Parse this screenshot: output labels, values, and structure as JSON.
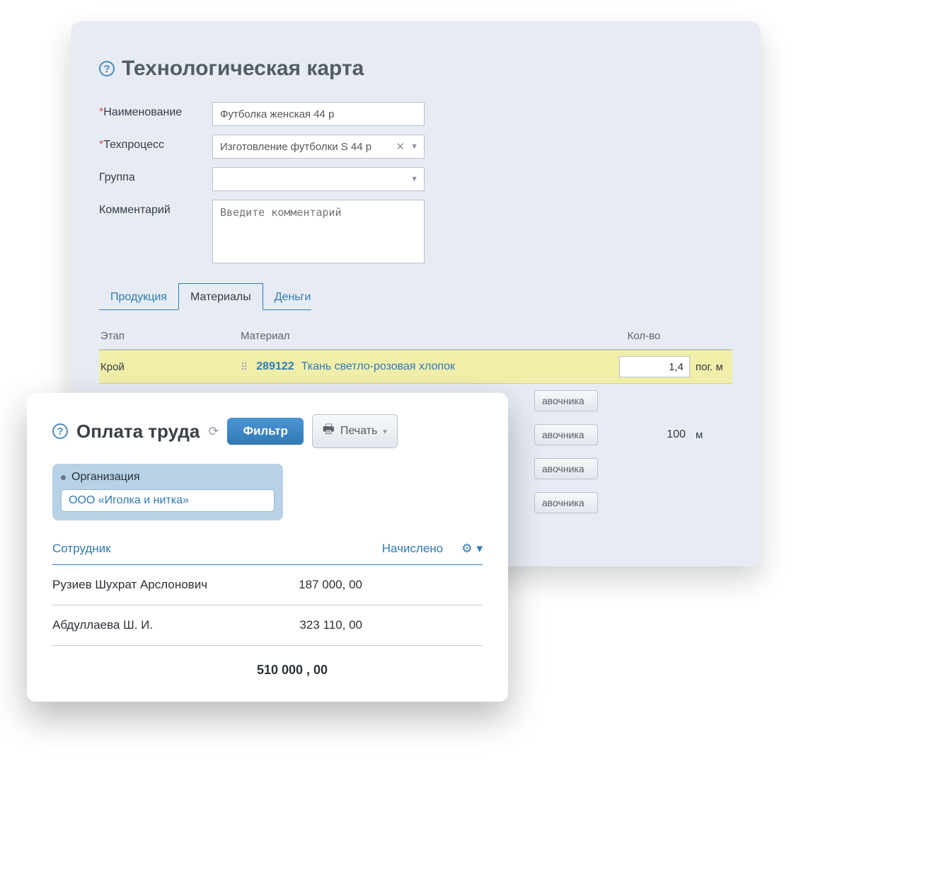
{
  "tech_card": {
    "title": "Технологическая карта",
    "fields": {
      "name_label": "Наименование",
      "name_value": "Футболка женская 44 р",
      "process_label": "Техпроцесс",
      "process_value": "Изготовление футболки S 44 р",
      "group_label": "Группа",
      "group_value": "",
      "comment_label": "Комментарий",
      "comment_placeholder": "Введите комментарий"
    },
    "tabs": {
      "products": "Продукция",
      "materials": "Материалы",
      "money": "Деньги"
    },
    "table": {
      "col_stage": "Этап",
      "col_material": "Материал",
      "col_qty": "Кол-во",
      "row1": {
        "stage": "Крой",
        "code": "289122",
        "name": "Ткань светло-розовая хлопок",
        "qty": "1,4",
        "unit": "пог. м"
      },
      "row2": {
        "qty": "100",
        "unit": "м"
      },
      "dir_btn": "авочника"
    }
  },
  "wages": {
    "title": "Оплата труда",
    "filter_btn": "Фильтр",
    "print_btn": "Печать",
    "org_label": "Организация",
    "org_value": "ООО «Иголка и нитка»",
    "col_employee": "Сотрудник",
    "col_accrued": "Начислено",
    "rows": [
      {
        "name": "Рузиев Шухрат Арслонович",
        "amount": "187 000, 00"
      },
      {
        "name": "Абдуллаева Ш. И.",
        "amount": "323 110, 00"
      }
    ],
    "total": "510 000 , 00"
  }
}
